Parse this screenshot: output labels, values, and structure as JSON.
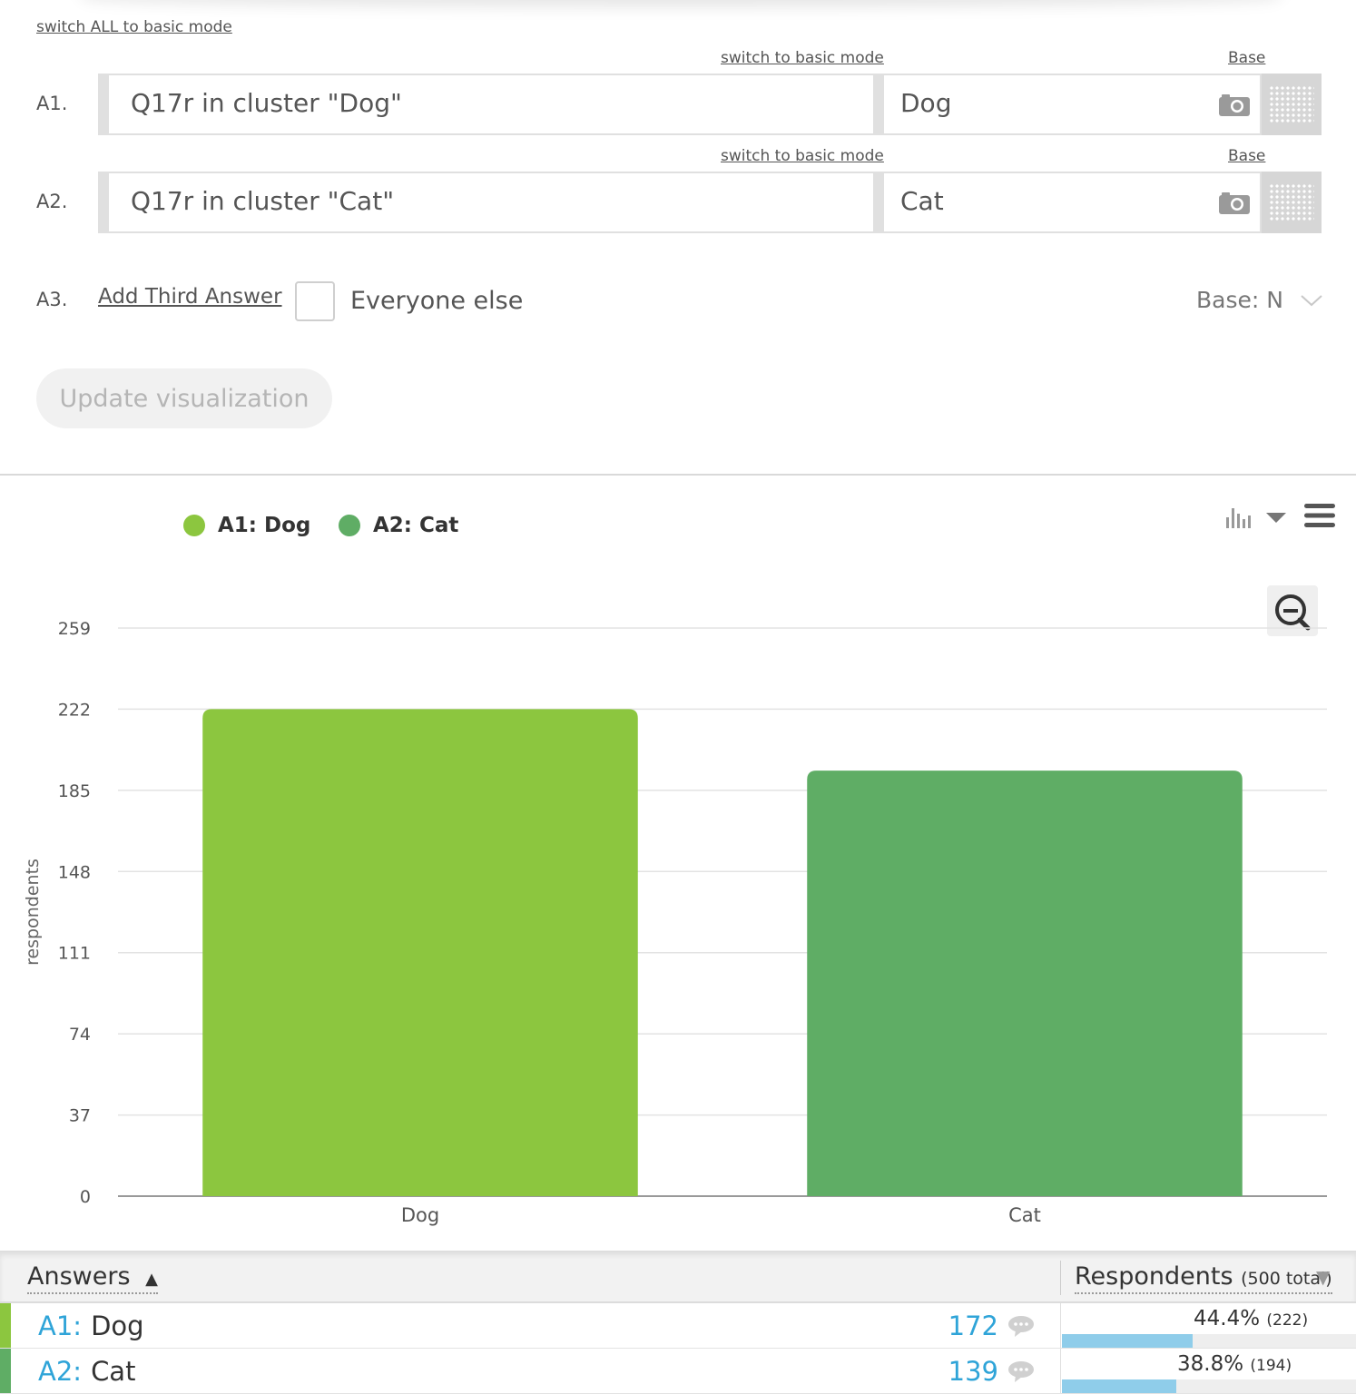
{
  "links": {
    "switch_all": "switch ALL to basic mode",
    "switch_basic": "switch to basic mode",
    "base": "Base"
  },
  "answers_form": [
    {
      "label": "A1.",
      "question": "Q17r in cluster \"Dog\"",
      "answer": "Dog"
    },
    {
      "label": "A2.",
      "question": "Q17r in cluster \"Cat\"",
      "answer": "Cat"
    }
  ],
  "a3": {
    "label": "A3.",
    "add_link": "Add Third Answer",
    "checkbox_label": "Everyone else",
    "base_select": "Base: N"
  },
  "update_button": "Update visualization",
  "colors": {
    "dog": "#8cc63f",
    "cat": "#5fad65",
    "link_blue": "#2fa4d8",
    "pct_bar": "#8fcdea"
  },
  "legend": [
    {
      "label": "A1: Dog",
      "color": "#8cc63f"
    },
    {
      "label": "A2: Cat",
      "color": "#5fad65"
    }
  ],
  "icons": {
    "chart_type": "bar-chart-icon",
    "dropdown": "caret-down-icon",
    "menu": "hamburger-menu-icon",
    "zoom": "zoom-out-icon",
    "camera": "camera-icon",
    "grid": "grid-icon",
    "comment": "comment-bubble-icon"
  },
  "chart_data": {
    "type": "bar",
    "categories": [
      "Dog",
      "Cat"
    ],
    "series": [
      {
        "name": "A1: Dog",
        "values": [
          222,
          null
        ]
      },
      {
        "name": "A2: Cat",
        "values": [
          null,
          194
        ]
      }
    ],
    "values": [
      222,
      194
    ],
    "colors": [
      "#8cc63f",
      "#5fad65"
    ],
    "title": "",
    "xlabel": "",
    "ylabel": "respondents",
    "yticks": [
      0,
      37,
      74,
      111,
      148,
      185,
      222,
      259
    ],
    "ylim": [
      0,
      259
    ],
    "grid": true,
    "legend_position": "top-left"
  },
  "table": {
    "header_answers": "Answers",
    "header_answers_sort": "▲",
    "header_respondents": "Respondents",
    "header_total": "(500 total)",
    "header_resp_sort": "▼",
    "rows": [
      {
        "code": "A1:",
        "name": "Dog",
        "count": "172",
        "pct": "44.4%",
        "n": "(222)",
        "fraction": 0.444,
        "color": "#8cc63f"
      },
      {
        "code": "A2:",
        "name": "Cat",
        "count": "139",
        "pct": "38.8%",
        "n": "(194)",
        "fraction": 0.388,
        "color": "#5fad65"
      }
    ]
  }
}
